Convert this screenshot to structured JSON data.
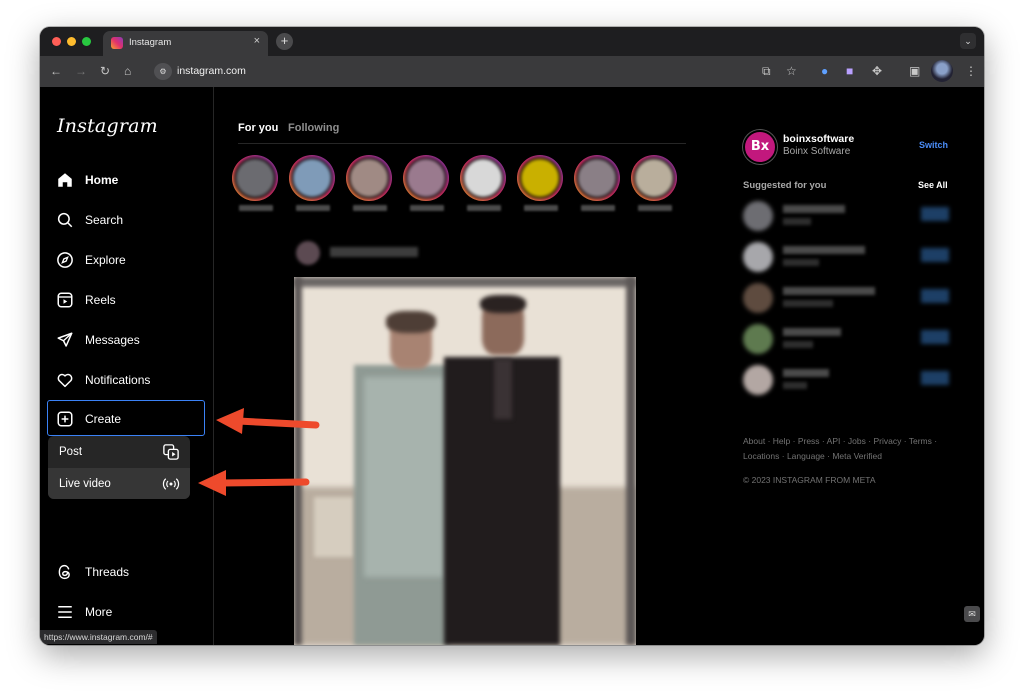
{
  "browser": {
    "tab_title": "Instagram",
    "tab_close": "×",
    "new_tab": "+",
    "address": "instagram.com",
    "status_url": "https://www.instagram.com/#"
  },
  "sidebar": {
    "logo": "Instagram",
    "items": [
      {
        "label": "Home",
        "icon": "home-icon"
      },
      {
        "label": "Search",
        "icon": "search-icon"
      },
      {
        "label": "Explore",
        "icon": "compass-icon"
      },
      {
        "label": "Reels",
        "icon": "reels-icon"
      },
      {
        "label": "Messages",
        "icon": "send-icon"
      },
      {
        "label": "Notifications",
        "icon": "heart-icon"
      },
      {
        "label": "Create",
        "icon": "plus-square-icon"
      }
    ],
    "create_menu": [
      {
        "label": "Post",
        "icon": "post-icon"
      },
      {
        "label": "Live video",
        "icon": "live-icon"
      }
    ],
    "threads": "Threads",
    "more": "More"
  },
  "feed": {
    "tabs": [
      "For you",
      "Following"
    ],
    "active_tab": "For you"
  },
  "profile": {
    "avatar_text": "Bx",
    "username": "boinxsoftware",
    "name": "Boinx Software",
    "switch_label": "Switch"
  },
  "suggestions": {
    "title": "Suggested for you",
    "see_all": "See All"
  },
  "footer": {
    "links": [
      "About",
      "Help",
      "Press",
      "API",
      "Jobs",
      "Privacy",
      "Terms",
      "Locations",
      "Language",
      "Meta Verified"
    ],
    "copyright": "© 2023 INSTAGRAM FROM META"
  },
  "colors": {
    "accent": "#3b82f6",
    "link": "#4b8df8",
    "arrow": "#ee4a2c",
    "brand": "#c2187d"
  }
}
